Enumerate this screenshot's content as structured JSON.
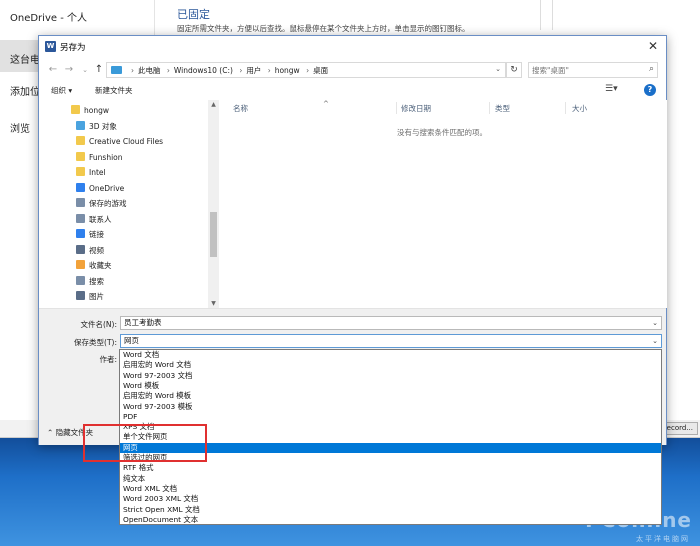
{
  "backstage": {
    "items": [
      "OneDrive - 个人",
      "这台电",
      "添加位",
      "浏览"
    ],
    "pinned_title": "已固定",
    "pinned_desc": "固定所需文件夹，方便以后查找。鼠标悬停在某个文件夹上方时，单击显示的图钉图标。",
    "record_button": "Record..."
  },
  "dialog": {
    "title": "另存为",
    "address": [
      "此电脑",
      "Windows10 (C:)",
      "用户",
      "hongw",
      "桌面"
    ],
    "search_placeholder": "搜索\"桌面\"",
    "toolbar": {
      "organize": "组织 ▾",
      "new_folder": "新建文件夹"
    },
    "nav_items": [
      {
        "label": "hongw",
        "color": "#f2c94c"
      },
      {
        "label": "3D 对象",
        "color": "#4aa3df"
      },
      {
        "label": "Creative Cloud Files",
        "color": "#f2c94c"
      },
      {
        "label": "Funshion",
        "color": "#f2c94c"
      },
      {
        "label": "Intel",
        "color": "#f2c94c"
      },
      {
        "label": "OneDrive",
        "color": "#2f80ed"
      },
      {
        "label": "保存的游戏",
        "color": "#7a8ea8"
      },
      {
        "label": "联系人",
        "color": "#7a8ea8"
      },
      {
        "label": "链接",
        "color": "#2f80ed"
      },
      {
        "label": "视频",
        "color": "#5a6d88"
      },
      {
        "label": "收藏夹",
        "color": "#f2a23a"
      },
      {
        "label": "搜索",
        "color": "#7a8ea8"
      },
      {
        "label": "图片",
        "color": "#5a6d88"
      }
    ],
    "columns": {
      "name": "名称",
      "modified": "修改日期",
      "type": "类型",
      "size": "大小"
    },
    "empty_message": "没有与搜索条件匹配的项。",
    "filename_label": "文件名(N):",
    "filename_value": "员工考勤表",
    "filetype_label": "保存类型(T):",
    "filetype_value": "网页",
    "author_label": "作者:",
    "hide_folders": "隐藏文件夹",
    "type_options": [
      "Word 文档",
      "启用宏的 Word 文档",
      "Word 97-2003 文档",
      "Word 模板",
      "启用宏的 Word 模板",
      "Word 97-2003 模板",
      "PDF",
      "XPS 文档",
      "单个文件网页",
      "网页",
      "筛选过的网页",
      "RTF 格式",
      "纯文本",
      "Word XML 文档",
      "Word 2003 XML 文档",
      "Strict Open XML 文档",
      "OpenDocument 文本"
    ],
    "selected_option_index": 9
  },
  "watermark": {
    "main": "PConline",
    "sub": "太平洋电脑网"
  }
}
